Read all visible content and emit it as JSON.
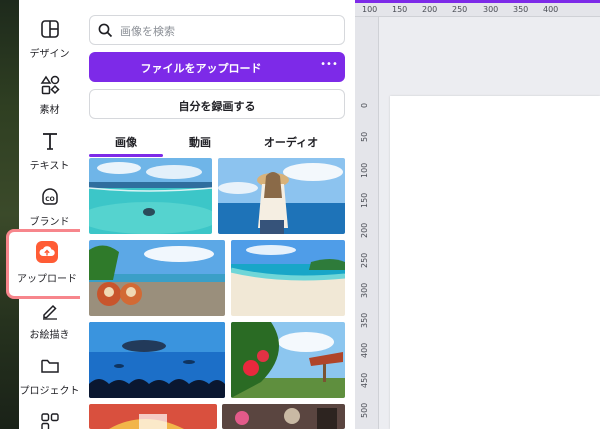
{
  "sidebar": {
    "items": [
      {
        "label": "デザイン",
        "icon": "design-icon"
      },
      {
        "label": "素材",
        "icon": "elements-icon"
      },
      {
        "label": "テキスト",
        "icon": "text-icon"
      },
      {
        "label": "ブランド",
        "icon": "brand-icon"
      },
      {
        "label": "アップロード",
        "icon": "upload-cloud-icon",
        "active": true
      },
      {
        "label": "お絵描き",
        "icon": "draw-icon"
      },
      {
        "label": "プロジェクト",
        "icon": "folder-icon"
      },
      {
        "label": "",
        "icon": "apps-icon"
      }
    ]
  },
  "panel": {
    "search_placeholder": "画像を検索",
    "upload_button": "ファイルをアップロード",
    "upload_more": "•••",
    "record_button": "自分を録画する",
    "tabs": [
      {
        "label": "画像",
        "active": true
      },
      {
        "label": "動画",
        "active": false
      },
      {
        "label": "オーディオ",
        "active": false
      }
    ]
  },
  "photos": [
    {
      "name": "photo-snorkel-reef"
    },
    {
      "name": "photo-woman-sea"
    },
    {
      "name": "photo-shisa-beach"
    },
    {
      "name": "photo-white-beach"
    },
    {
      "name": "photo-aquarium-shark"
    },
    {
      "name": "photo-hibiscus-garden"
    },
    {
      "name": "photo-partial-left"
    },
    {
      "name": "photo-partial-right"
    }
  ],
  "ruler": {
    "top_ticks": [
      "100",
      "150",
      "200",
      "250",
      "300",
      "350",
      "400"
    ],
    "left_ticks": [
      "0",
      "50",
      "100",
      "150",
      "200",
      "250",
      "300",
      "350",
      "400",
      "450",
      "500"
    ]
  },
  "colors": {
    "accent": "#7d2ae8",
    "upload_badge": "#ff5c35",
    "highlight": "#f7868c"
  }
}
